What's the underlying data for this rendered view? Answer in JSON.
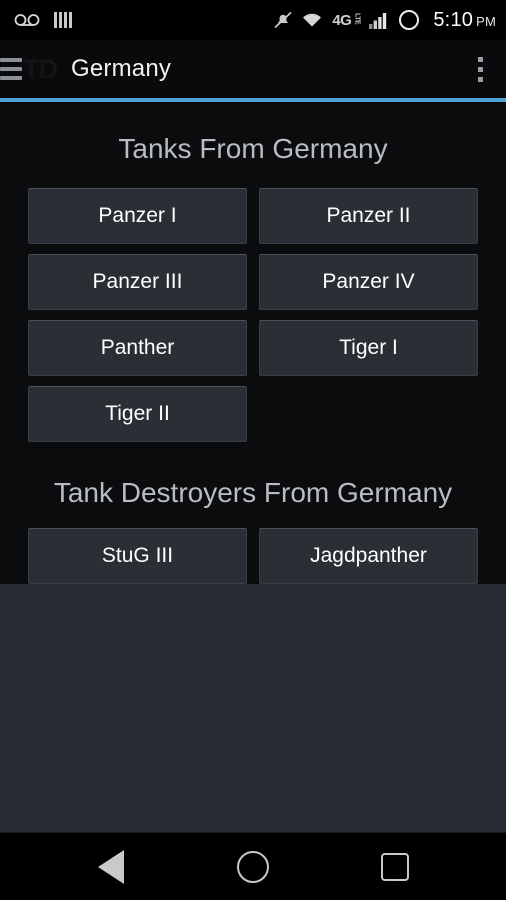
{
  "status_bar": {
    "left_icons": [
      {
        "name": "voicemail-icon",
        "glyph": "∞"
      },
      {
        "name": "equalizer-bars-icon",
        "glyph": "|||"
      }
    ],
    "right_icons": [
      {
        "name": "ringer-muted-icon"
      },
      {
        "name": "wifi-icon"
      },
      {
        "name": "network-4g-lte-icon",
        "primary": "4G",
        "secondary": "LTE"
      },
      {
        "name": "signal-bars-icon"
      },
      {
        "name": "alarm-circle-icon"
      }
    ],
    "time": "5:10",
    "ampm": "PM"
  },
  "action_bar": {
    "menu_icon": "hamburger-menu-icon",
    "app_logo": "TD",
    "title": "Germany",
    "overflow_icon": "overflow-menu-icon",
    "accent_color": "#4ea3d4"
  },
  "sections": [
    {
      "title": "Tanks From Germany",
      "items": [
        "Panzer I",
        "Panzer II",
        "Panzer III",
        "Panzer IV",
        "Panther",
        "Tiger I",
        "Tiger II"
      ]
    },
    {
      "title": "Tank Destroyers From Germany",
      "items": [
        "StuG III",
        "Jagdpanther"
      ]
    }
  ],
  "nav_bar": {
    "back_label": "Back",
    "home_label": "Home",
    "recents_label": "Recent apps"
  },
  "theme": {
    "background": "#0b0c0e",
    "panel": "#262a31",
    "tile": "#2a2e35",
    "accent": "#4ea3d4",
    "text_primary": "#ffffff",
    "text_heading": "#b9bcc0"
  }
}
